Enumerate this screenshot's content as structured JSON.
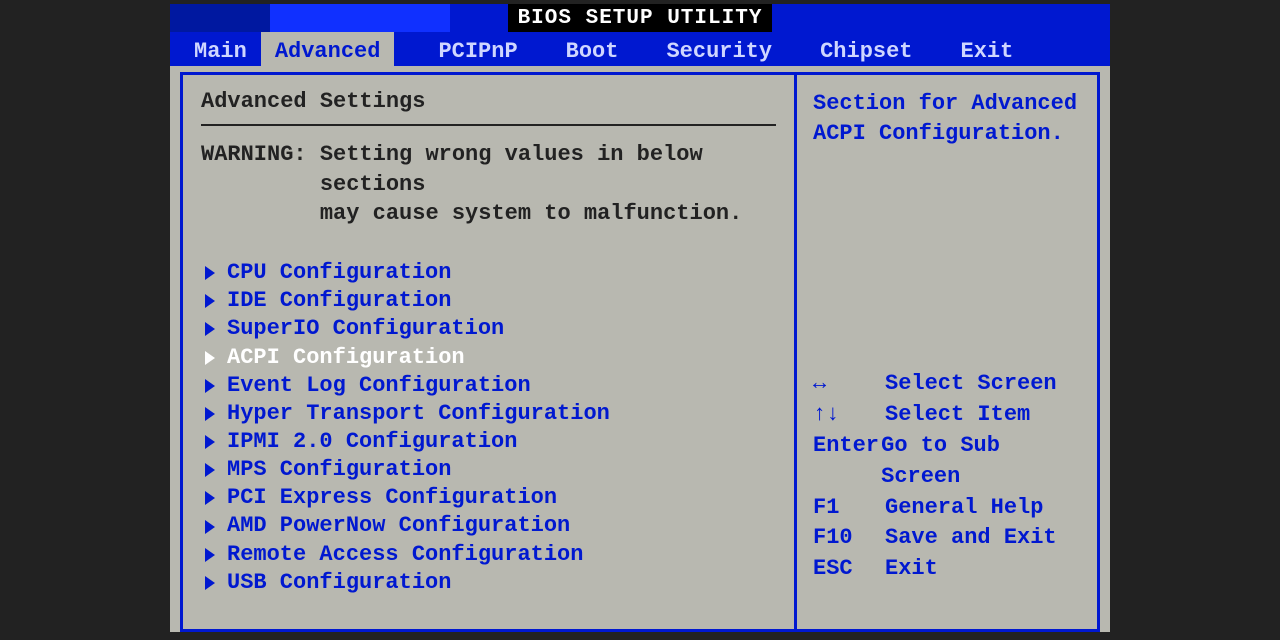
{
  "title": "BIOS SETUP UTILITY",
  "tabs": [
    {
      "label": "Main",
      "active": false
    },
    {
      "label": "Advanced",
      "active": true
    },
    {
      "label": "PCIPnP",
      "active": false
    },
    {
      "label": "Boot",
      "active": false
    },
    {
      "label": "Security",
      "active": false
    },
    {
      "label": "Chipset",
      "active": false
    },
    {
      "label": "Exit",
      "active": false
    }
  ],
  "section_title": "Advanced Settings",
  "warning_label": "WARNING: ",
  "warning_body": "Setting wrong values in below sections\nmay cause system to malfunction.",
  "entries": [
    {
      "label": "CPU Configuration",
      "selected": false
    },
    {
      "label": "IDE Configuration",
      "selected": false
    },
    {
      "label": "SuperIO Configuration",
      "selected": false
    },
    {
      "label": "ACPI Configuration",
      "selected": true
    },
    {
      "label": "Event Log Configuration",
      "selected": false
    },
    {
      "label": "Hyper Transport Configuration",
      "selected": false
    },
    {
      "label": "IPMI 2.0 Configuration",
      "selected": false
    },
    {
      "label": "MPS Configuration",
      "selected": false
    },
    {
      "label": "PCI Express Configuration",
      "selected": false
    },
    {
      "label": "AMD PowerNow Configuration",
      "selected": false
    },
    {
      "label": "Remote Access Configuration",
      "selected": false
    },
    {
      "label": "USB Configuration",
      "selected": false
    }
  ],
  "help_text": "Section for Advanced ACPI Configuration.",
  "keys": [
    {
      "k": "↔",
      "d": "Select Screen"
    },
    {
      "k": "↑↓",
      "d": "Select Item"
    },
    {
      "k": "Enter",
      "d": "Go to Sub Screen"
    },
    {
      "k": "F1",
      "d": "General Help"
    },
    {
      "k": "F10",
      "d": "Save and Exit"
    },
    {
      "k": "ESC",
      "d": "Exit"
    }
  ]
}
